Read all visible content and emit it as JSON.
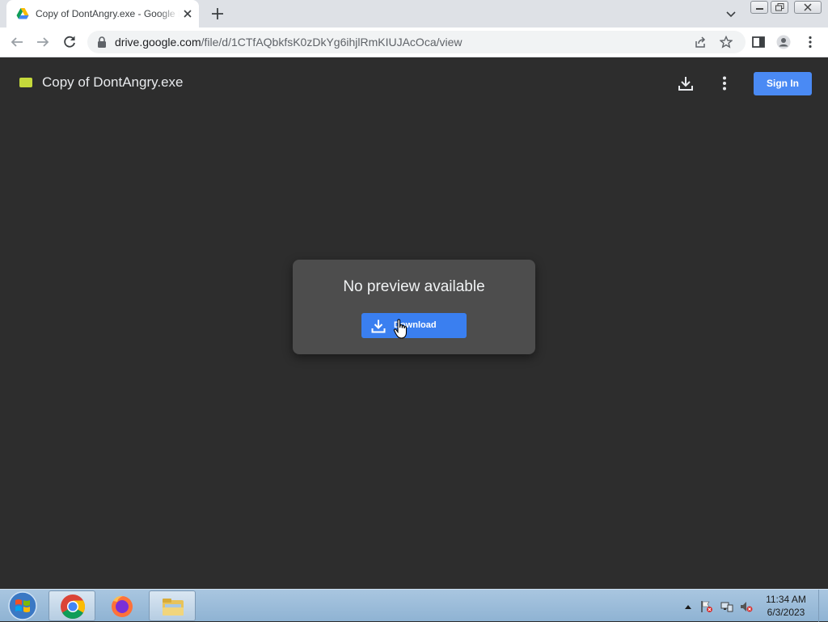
{
  "browser": {
    "tab": {
      "title": "Copy of DontAngry.exe - Google Drive"
    },
    "url": {
      "host": "drive.google.com",
      "path": "/file/d/1CTfAQbkfsK0zDkYg6ihjlRmKIUJAcOca/view"
    }
  },
  "drive": {
    "file_title": "Copy of DontAngry.exe",
    "sign_in_label": "Sign In",
    "preview_message": "No preview available",
    "download_label": "Download"
  },
  "taskbar": {
    "time": "11:34 AM",
    "date": "6/3/2023"
  },
  "colors": {
    "page_bg": "#2d2d2d",
    "card_bg": "#4d4d4d",
    "accent_blue": "#3a7ff0",
    "file_icon": "#c5d93b"
  }
}
